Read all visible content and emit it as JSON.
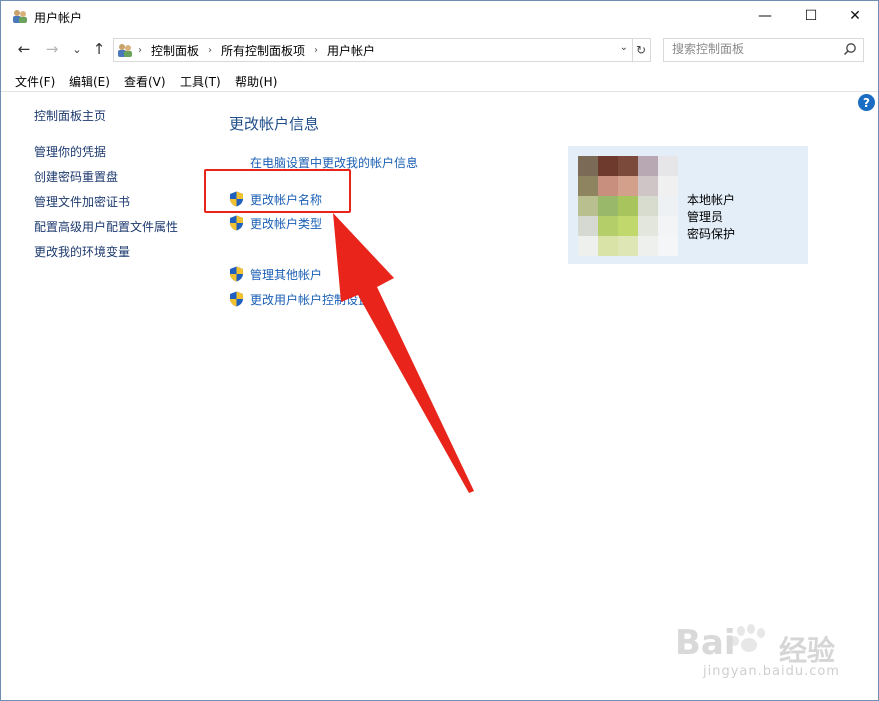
{
  "window": {
    "title": "用户帐户",
    "controls": {
      "minimize": "—",
      "maximize": "☐",
      "close": "✕"
    }
  },
  "nav": {
    "back": "←",
    "forward": "→",
    "recent": "⌄",
    "up": "↑"
  },
  "address": {
    "crumbs": [
      "控制面板",
      "所有控制面板项",
      "用户帐户"
    ],
    "separator": "›",
    "dropdown": "⌄",
    "refresh": "↻"
  },
  "search": {
    "placeholder": "搜索控制面板"
  },
  "menu": [
    "文件(F)",
    "编辑(E)",
    "查看(V)",
    "工具(T)",
    "帮助(H)"
  ],
  "help": "?",
  "sidebar": {
    "home": "控制面板主页",
    "items": [
      "管理你的凭据",
      "创建密码重置盘",
      "管理文件加密证书",
      "配置高级用户配置文件属性",
      "更改我的环境变量"
    ]
  },
  "main": {
    "heading": "更改帐户信息",
    "pc_settings_link": "在电脑设置中更改我的帐户信息",
    "change_name": "更改帐户名称",
    "change_type": "更改帐户类型",
    "manage_other": "管理其他帐户",
    "uac_settings": "更改用户帐户控制设置"
  },
  "account": {
    "lines": [
      "本地帐户",
      "管理员",
      "密码保护"
    ]
  },
  "watermark": {
    "logo": "Bai",
    "suffix": "经验",
    "url": "jingyan.baidu.com"
  },
  "colors": {
    "link": "#1a5fb4",
    "heading": "#1f4e8a",
    "highlight": "#e8241b",
    "panel": "#e3eef9"
  }
}
